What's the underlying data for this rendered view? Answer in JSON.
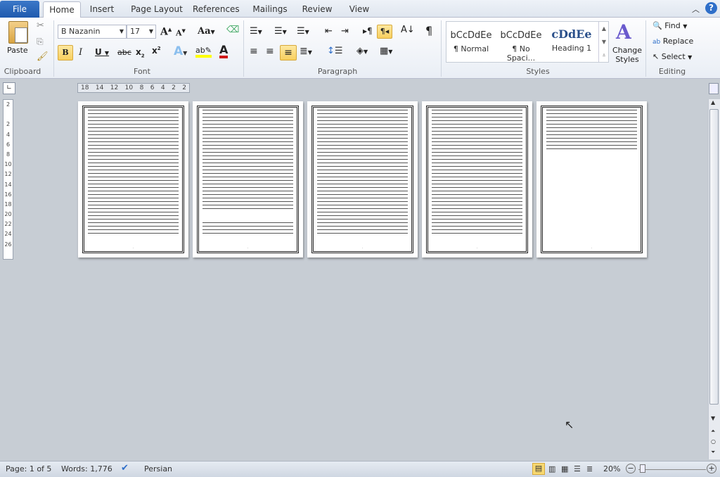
{
  "tabs": {
    "file": "File",
    "home": "Home",
    "insert": "Insert",
    "page_layout": "Page Layout",
    "references": "References",
    "mailings": "Mailings",
    "review": "Review",
    "view": "View"
  },
  "clipboard": {
    "paste": "Paste",
    "label": "Clipboard"
  },
  "font": {
    "name": "B Nazanin",
    "size": "17",
    "label": "Font",
    "change_case": "Aa"
  },
  "paragraph": {
    "label": "Paragraph",
    "pilcrow": "¶"
  },
  "styles": {
    "label": "Styles",
    "items": [
      {
        "sample": "bCcDdEe",
        "name": "¶ Normal"
      },
      {
        "sample": "bCcDdEe",
        "name": "¶ No Spaci..."
      },
      {
        "sample": "cDdEe",
        "name": "Heading 1"
      }
    ],
    "change_styles": "Change Styles"
  },
  "editing": {
    "label": "Editing",
    "find": "Find",
    "replace": "Replace",
    "select": "Select"
  },
  "ruler": {
    "ticks": [
      "18",
      "14",
      "12",
      "10",
      "8",
      "6",
      "4",
      "2",
      "2"
    ]
  },
  "vruler": {
    "ticks": [
      "2",
      "",
      "2",
      "4",
      "6",
      "8",
      "10",
      "12",
      "14",
      "16",
      "18",
      "20",
      "22",
      "24",
      "26"
    ]
  },
  "status": {
    "page": "Page: 1 of 5",
    "words": "Words: 1,776",
    "language": "Persian",
    "zoom": "20%"
  },
  "colors": {
    "file_tab": "#2a64b8",
    "selected": "#f8cf5e",
    "font_color": "#d01919",
    "highlight": "#ffff00"
  },
  "document": {
    "page_count": 5
  }
}
